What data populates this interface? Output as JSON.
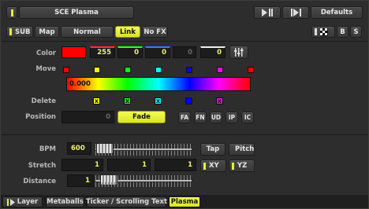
{
  "header": {
    "title": "SCE Plasma",
    "defaults_label": "Defaults"
  },
  "toolbar": {
    "sub_label": "SUB",
    "map_label": "Map",
    "blend_mode": "Normal",
    "link_label": "Link",
    "nofx_label": "No FX",
    "b_label": "B",
    "s_label": "S"
  },
  "color": {
    "label": "Color",
    "swatch_hex": "#ff0000",
    "values": [
      "255",
      "0",
      "0",
      "0",
      "0"
    ]
  },
  "move": {
    "label": "Move",
    "swatches": [
      "#ff0000",
      "#ffff00",
      "#00ff00",
      "#00ffff",
      "#0000ff",
      "#ff00ff",
      "#ff0000"
    ]
  },
  "gradient": {
    "value": "0.000"
  },
  "delete": {
    "label": "Delete",
    "boxes": [
      {
        "color": "#ffff00",
        "mark": "x"
      },
      {
        "color": "#00ff00",
        "mark": "x"
      },
      {
        "color": "#00ffff",
        "mark": "x"
      },
      {
        "color": "#0000ff",
        "mark": ""
      },
      {
        "color": "#ff00ff",
        "mark": "x"
      }
    ]
  },
  "position": {
    "label": "Position",
    "value": "0",
    "fade_label": "Fade",
    "mode_buttons": [
      "FA",
      "FN",
      "UD",
      "IP",
      "IC"
    ]
  },
  "bpm": {
    "label": "BPM",
    "value": "600",
    "tap_label": "Tap",
    "pitch_label": "Pitch"
  },
  "stretch": {
    "label": "Stretch",
    "values": [
      "1",
      "1",
      "1"
    ],
    "xy_label": "XY",
    "yz_label": "YZ"
  },
  "distance": {
    "label": "Distance",
    "value": "1"
  },
  "tabs": [
    {
      "label": "Layer",
      "active": false
    },
    {
      "label": "Metaballs",
      "active": false
    },
    {
      "label": "Ticker / Scrolling Text",
      "active": false
    },
    {
      "label": "Plasma",
      "active": true
    }
  ],
  "colors": {
    "accent": "#e5f03a",
    "panel_bg": "#2d2d2d",
    "field_text": "#f0f070"
  }
}
